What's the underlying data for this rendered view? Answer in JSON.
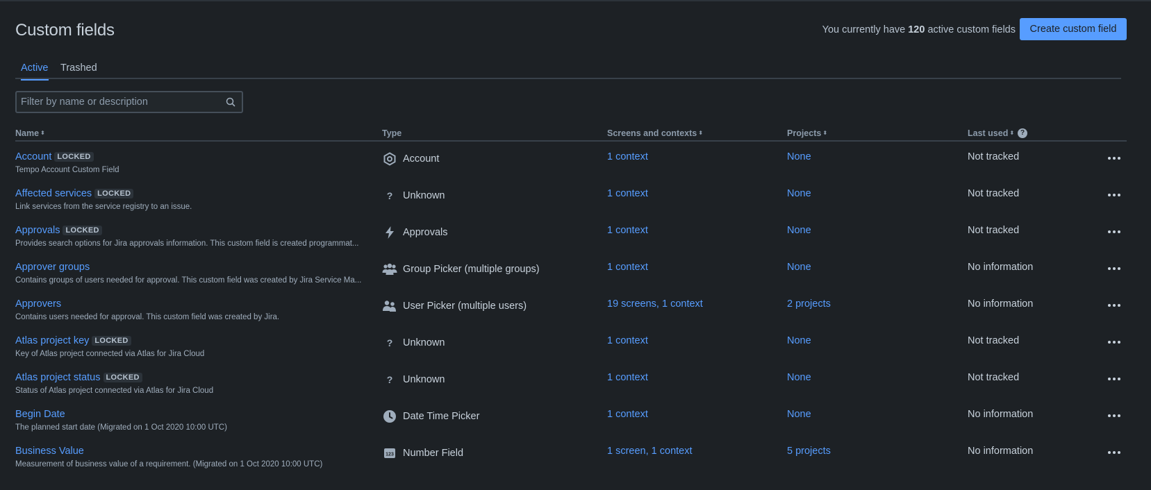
{
  "page": {
    "title": "Custom fields",
    "summary_prefix": "You currently have ",
    "summary_count": "120",
    "summary_suffix": " active custom fields",
    "create_button": "Create custom field"
  },
  "tabs": [
    {
      "label": "Active",
      "selected": true
    },
    {
      "label": "Trashed",
      "selected": false
    }
  ],
  "filter": {
    "placeholder": "Filter by name or description",
    "value": ""
  },
  "columns": {
    "name": "Name",
    "type": "Type",
    "screens": "Screens and contexts",
    "projects": "Projects",
    "last_used": "Last used"
  },
  "rows": [
    {
      "name": "Account",
      "locked": "LOCKED",
      "description": "Tempo Account Custom Field",
      "type": "Account",
      "type_icon": "hexagon-icon",
      "screens": "1 context",
      "projects": "None",
      "last_used": "Not tracked"
    },
    {
      "name": "Affected services",
      "locked": "LOCKED",
      "description": "Link services from the service registry to an issue.",
      "type": "Unknown",
      "type_icon": "question-icon",
      "screens": "1 context",
      "projects": "None",
      "last_used": "Not tracked"
    },
    {
      "name": "Approvals",
      "locked": "LOCKED",
      "description": "Provides search options for Jira approvals information. This custom field is created programmat...",
      "type": "Approvals",
      "type_icon": "lightning-icon",
      "screens": "1 context",
      "projects": "None",
      "last_used": "Not tracked"
    },
    {
      "name": "Approver groups",
      "locked": "",
      "description": "Contains groups of users needed for approval. This custom field was created by Jira Service Ma...",
      "type": "Group Picker (multiple groups)",
      "type_icon": "group-icon",
      "screens": "1 context",
      "projects": "None",
      "last_used": "No information"
    },
    {
      "name": "Approvers",
      "locked": "",
      "description": "Contains users needed for approval. This custom field was created by Jira.",
      "type": "User Picker (multiple users)",
      "type_icon": "users-icon",
      "screens": "19 screens, 1 context",
      "projects": "2 projects",
      "last_used": "No information"
    },
    {
      "name": "Atlas project key",
      "locked": "LOCKED",
      "description": "Key of Atlas project connected via Atlas for Jira Cloud",
      "type": "Unknown",
      "type_icon": "question-icon",
      "screens": "1 context",
      "projects": "None",
      "last_used": "Not tracked"
    },
    {
      "name": "Atlas project status",
      "locked": "LOCKED",
      "description": "Status of Atlas project connected via Atlas for Jira Cloud",
      "type": "Unknown",
      "type_icon": "question-icon",
      "screens": "1 context",
      "projects": "None",
      "last_used": "Not tracked"
    },
    {
      "name": "Begin Date",
      "locked": "",
      "description": "The planned start date (Migrated on 1 Oct 2020 10:00 UTC)",
      "type": "Date Time Picker",
      "type_icon": "clock-icon",
      "screens": "1 context",
      "projects": "None",
      "last_used": "No information"
    },
    {
      "name": "Business Value",
      "locked": "",
      "description": "Measurement of business value of a requirement. (Migrated on 1 Oct 2020 10:00 UTC)",
      "type": "Number Field",
      "type_icon": "number-icon",
      "screens": "1 screen, 1 context",
      "projects": "5 projects",
      "last_used": "No information"
    }
  ]
}
